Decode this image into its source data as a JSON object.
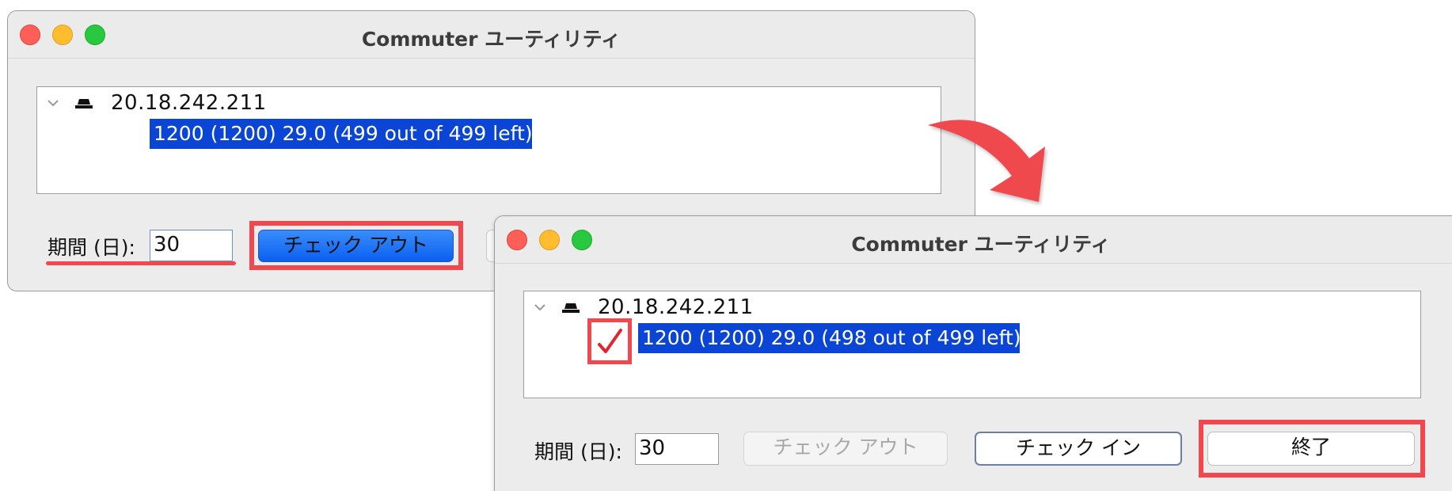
{
  "colors": {
    "highlight": "#f0484e",
    "selection": "#0b45d6",
    "primary_button": "#0a60f0",
    "arrow": "#f0484e"
  },
  "arrow_icon": "curved-arrow-down-right",
  "window_before": {
    "title": "Commuter ユーティリティ",
    "tree": {
      "host": "20.18.242.211",
      "license": "1200 (1200) 29.0 (499 out of 499 left)"
    },
    "period_label": "期間 (日):",
    "period_value": "30",
    "checkout_label": "チェック アウト"
  },
  "window_after": {
    "title": "Commuter ユーティリティ",
    "tree": {
      "host": "20.18.242.211",
      "license": "1200 (1200) 29.0 (498 out of 499 left)",
      "checkmark": "✓"
    },
    "period_label": "期間 (日):",
    "period_value": "30",
    "checkout_label": "チェック アウト",
    "checkin_label": "チェック イン",
    "quit_label": "終了"
  }
}
